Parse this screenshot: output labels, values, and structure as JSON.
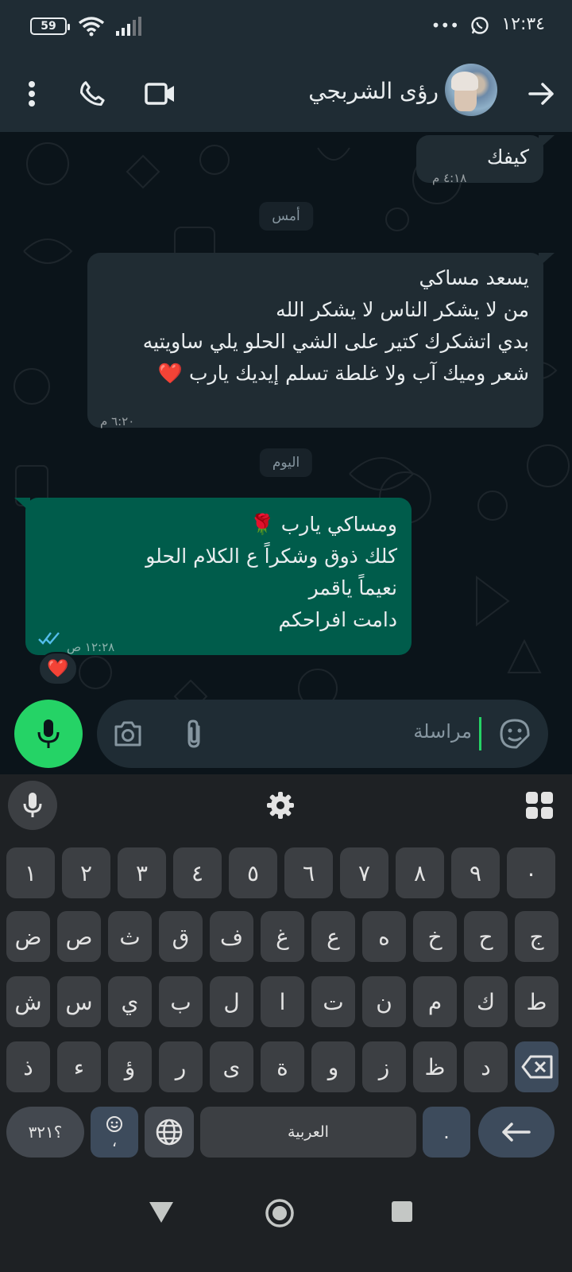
{
  "status_bar": {
    "time": "١٢:٣٤",
    "battery": "59",
    "more": "•••"
  },
  "header": {
    "contact_name": "رؤى الشربجي",
    "back_icon": "arrow-forward-icon",
    "video_icon": "video-call-icon",
    "call_icon": "phone-icon",
    "menu_icon": "more-vertical-icon"
  },
  "chat": {
    "messages": [
      {
        "direction": "in",
        "lines": [
          "كيفك"
        ],
        "time": "٤:١٨ م"
      },
      {
        "direction": "in",
        "lines": [
          "يسعد مساكي",
          "من لا يشكر الناس لا يشكر الله",
          "بدي اتشكرك كتير على الشي الحلو يلي ساويتيه",
          "شعر وميك آب ولا غلطة تسلم إيديك يارب ❤️"
        ],
        "time": "٦:٢٠ م"
      },
      {
        "direction": "out",
        "lines": [
          "ومساكي يارب 🌹",
          "كلك ذوق وشكراً ع الكلام الحلو",
          "نعيماً ياقمر",
          "دامت افراحكم"
        ],
        "time": "١٢:٢٨ ص",
        "read": true,
        "reaction": "❤️"
      }
    ],
    "day_chips": [
      "أمس",
      "اليوم"
    ]
  },
  "composer": {
    "placeholder": "مراسلة"
  },
  "keyboard": {
    "numbers": [
      "١",
      "٢",
      "٣",
      "٤",
      "٥",
      "٦",
      "٧",
      "٨",
      "٩",
      "٠"
    ],
    "row1": [
      "ض",
      "ص",
      "ث",
      "ق",
      "ف",
      "غ",
      "ع",
      "ه",
      "خ",
      "ح",
      "ج"
    ],
    "row2": [
      "ش",
      "س",
      "ي",
      "ب",
      "ل",
      "ا",
      "ت",
      "ن",
      "م",
      "ك",
      "ط"
    ],
    "row3": [
      "ذ",
      "ء",
      "ؤ",
      "ر",
      "ى",
      "ة",
      "و",
      "ز",
      "ظ",
      "د"
    ],
    "symbols_key": "؟٣٢١",
    "emoji_comma": "،",
    "space_label": "العربية",
    "dot_key": "."
  },
  "colors": {
    "accent_green": "#25d366",
    "outgoing_bubble": "#005c4b",
    "incoming_bubble": "#202c33",
    "read_ticks": "#53bdeb"
  }
}
